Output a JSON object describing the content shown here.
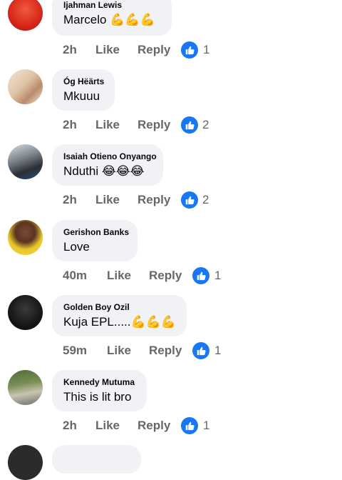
{
  "comments": [
    {
      "author": "Ijahman Lewis",
      "text": "Marcelo 💪💪💪",
      "time": "2h",
      "like": "Like",
      "reply": "Reply",
      "reactions": "1"
    },
    {
      "author": "Óg Hëärts",
      "text": "Mkuuu",
      "time": "2h",
      "like": "Like",
      "reply": "Reply",
      "reactions": "2"
    },
    {
      "author": "Isaiah Otieno Onyango",
      "text": "Nduthi 😂😂😂",
      "time": "2h",
      "like": "Like",
      "reply": "Reply",
      "reactions": "2"
    },
    {
      "author": "Gerishon Banks",
      "text": "Love",
      "time": "40m",
      "like": "Like",
      "reply": "Reply",
      "reactions": "1"
    },
    {
      "author": "Golden Boy Ozil",
      "text": "Kuja EPL.....💪💪💪",
      "time": "59m",
      "like": "Like",
      "reply": "Reply",
      "reactions": "1"
    },
    {
      "author": "Kennedy Mutuma",
      "text": "This is lit bro",
      "time": "2h",
      "like": "Like",
      "reply": "Reply",
      "reactions": "1"
    }
  ],
  "icons": {
    "reaction": "thumbs-up-icon"
  },
  "colors": {
    "accent": "#1877f2",
    "bubble": "#f0f2f5",
    "meta": "#65676b"
  }
}
